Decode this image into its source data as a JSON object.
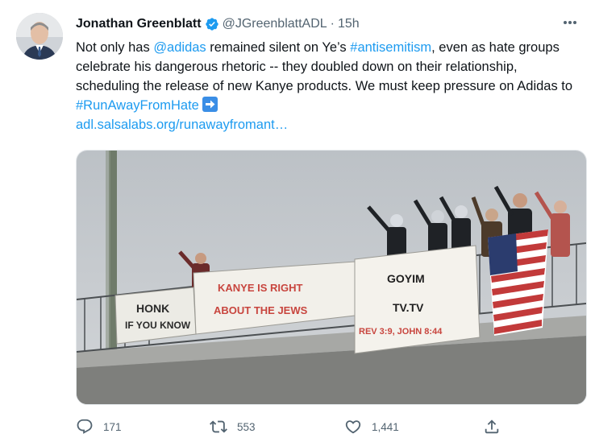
{
  "tweet": {
    "author_name": "Jonathan Greenblatt",
    "handle": "@JGreenblattADL",
    "separator": "·",
    "time": "15h",
    "text": {
      "p1": "Not only has ",
      "mention": "@adidas",
      "p2": " remained silent on Ye’s ",
      "hashtag1": "#antisemitism",
      "p3": ", even as hate groups celebrate his dangerous rhetoric -- they doubled down on their relationship, scheduling the release of new Kanye products. We must keep pressure on Adidas to ",
      "hashtag2": "#RunAwayFromHate",
      "link": "adl.salsalabs.org/runawayfromant…"
    },
    "photo": {
      "banner1_line1": "HONK",
      "banner1_line2": "IF YOU KNOW",
      "banner2_line1": "KANYE IS RIGHT",
      "banner2_line2": "ABOUT THE JEWS",
      "banner3_line1": "GOYIM",
      "banner3_line2": "TV.TV",
      "banner3_line3": "REV 3:9, JOHN 8:44"
    },
    "actions": {
      "replies": "171",
      "retweets": "553",
      "likes": "1,441"
    },
    "colors": {
      "link": "#1d9bf0",
      "secondary_text": "#536471",
      "verified": "#1d9bf0"
    }
  }
}
